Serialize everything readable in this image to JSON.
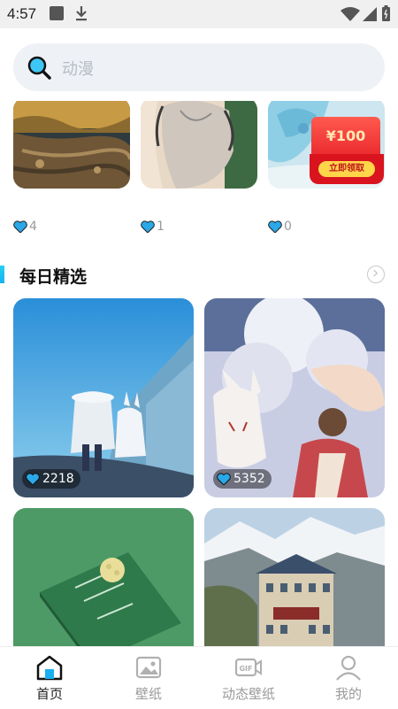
{
  "status_bar": {
    "time": "4:57"
  },
  "search": {
    "placeholder": "动漫"
  },
  "top_row": {
    "items": [
      {
        "likes": "4"
      },
      {
        "likes": "1"
      },
      {
        "likes": "0"
      }
    ],
    "promo": {
      "amount": "¥100",
      "button": "立即领取"
    }
  },
  "section": {
    "title": "每日精选"
  },
  "featured": [
    {
      "likes": "2218"
    },
    {
      "likes": "5352"
    }
  ],
  "tabbar": {
    "items": [
      {
        "label": "首页"
      },
      {
        "label": "壁纸"
      },
      {
        "label": "动态壁纸"
      },
      {
        "label": "我的"
      }
    ]
  },
  "colors": {
    "accent": "#1ab0f0",
    "heart": "#2aa8e8",
    "inactive": "#9a9a9a"
  }
}
